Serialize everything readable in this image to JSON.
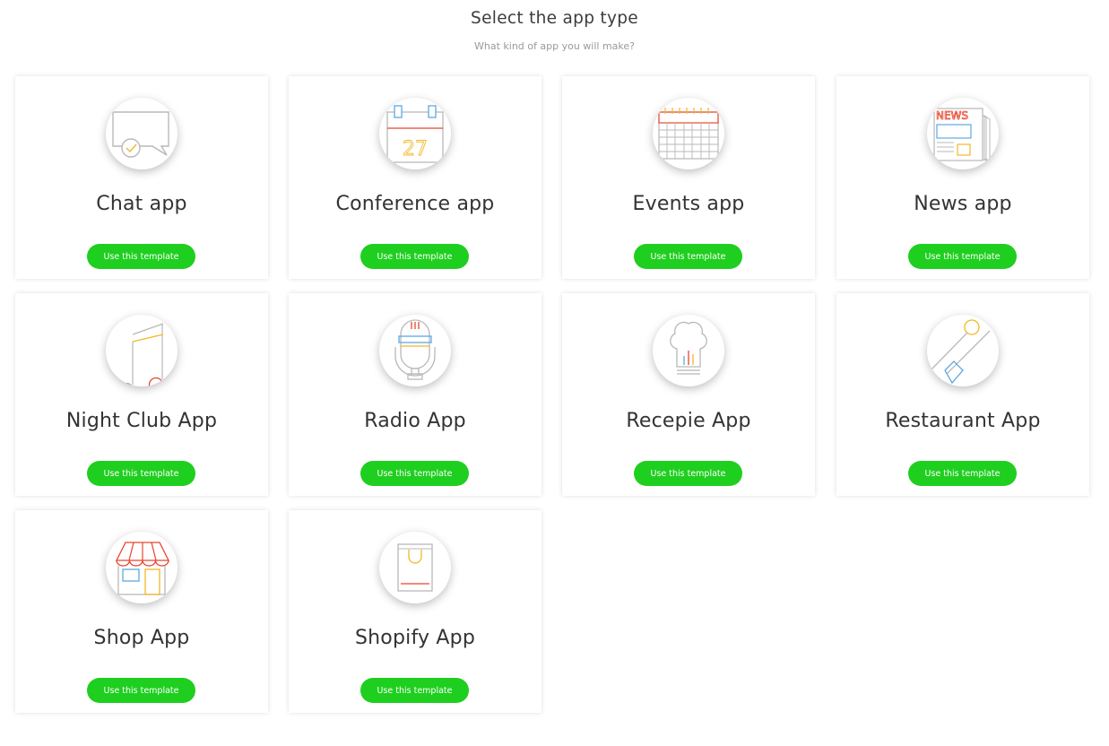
{
  "header": {
    "title": "Select the app type",
    "subtitle": "What kind of app you will make?"
  },
  "colors": {
    "accent_button": "#1fcf1f",
    "icon_red": "#e8452e",
    "icon_blue": "#5aa9e6",
    "icon_yellow": "#f2b825",
    "icon_gray": "#b8b8b8"
  },
  "cards": [
    {
      "title": "Chat app",
      "button": "Use this template",
      "icon": "chat-bubble-icon"
    },
    {
      "title": "Conference app",
      "button": "Use this template",
      "icon": "calendar-icon",
      "icon_text": "27"
    },
    {
      "title": "Events app",
      "button": "Use this template",
      "icon": "events-calendar-icon"
    },
    {
      "title": "News app",
      "button": "Use this template",
      "icon": "newspaper-icon",
      "icon_text": "NEWS"
    },
    {
      "title": "Night Club App",
      "button": "Use this template",
      "icon": "music-note-icon"
    },
    {
      "title": "Radio App",
      "button": "Use this template",
      "icon": "microphone-icon"
    },
    {
      "title": "Recepie App",
      "button": "Use this template",
      "icon": "chef-hat-icon"
    },
    {
      "title": "Restaurant App",
      "button": "Use this template",
      "icon": "spoon-fork-icon"
    },
    {
      "title": "Shop App",
      "button": "Use this template",
      "icon": "storefront-icon"
    },
    {
      "title": "Shopify App",
      "button": "Use this template",
      "icon": "shopping-bag-icon"
    }
  ]
}
